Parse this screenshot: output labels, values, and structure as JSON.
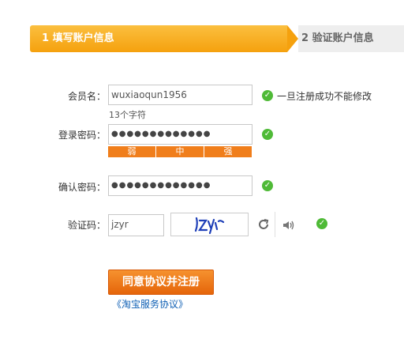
{
  "steps": [
    {
      "label": "1 填写账户信息"
    },
    {
      "label": "2 验证账户信息"
    }
  ],
  "form": {
    "username": {
      "label": "会员名：",
      "value": "wuxiaoqun1956",
      "hint": "一旦注册成功不能修改",
      "count": "13个字符"
    },
    "password": {
      "label": "登录密码：",
      "value": "●●●●●●●●●●●●●"
    },
    "strength": [
      "弱",
      "中",
      "强"
    ],
    "confirm": {
      "label": "确认密码：",
      "value": "●●●●●●●●●●●●●"
    },
    "captcha": {
      "label": "验证码：",
      "value": "jzyr",
      "image_text": "jzyr"
    }
  },
  "submit_label": "同意协议并注册",
  "agreement_link": "《淘宝服务协议》",
  "icons": {
    "check": "check-circle-icon",
    "refresh": "refresh-icon",
    "speaker": "speaker-icon"
  },
  "colors": {
    "accent": "#f5a10e",
    "button": "#e5650a",
    "check": "#4fba37",
    "link": "#0e5fb4"
  }
}
